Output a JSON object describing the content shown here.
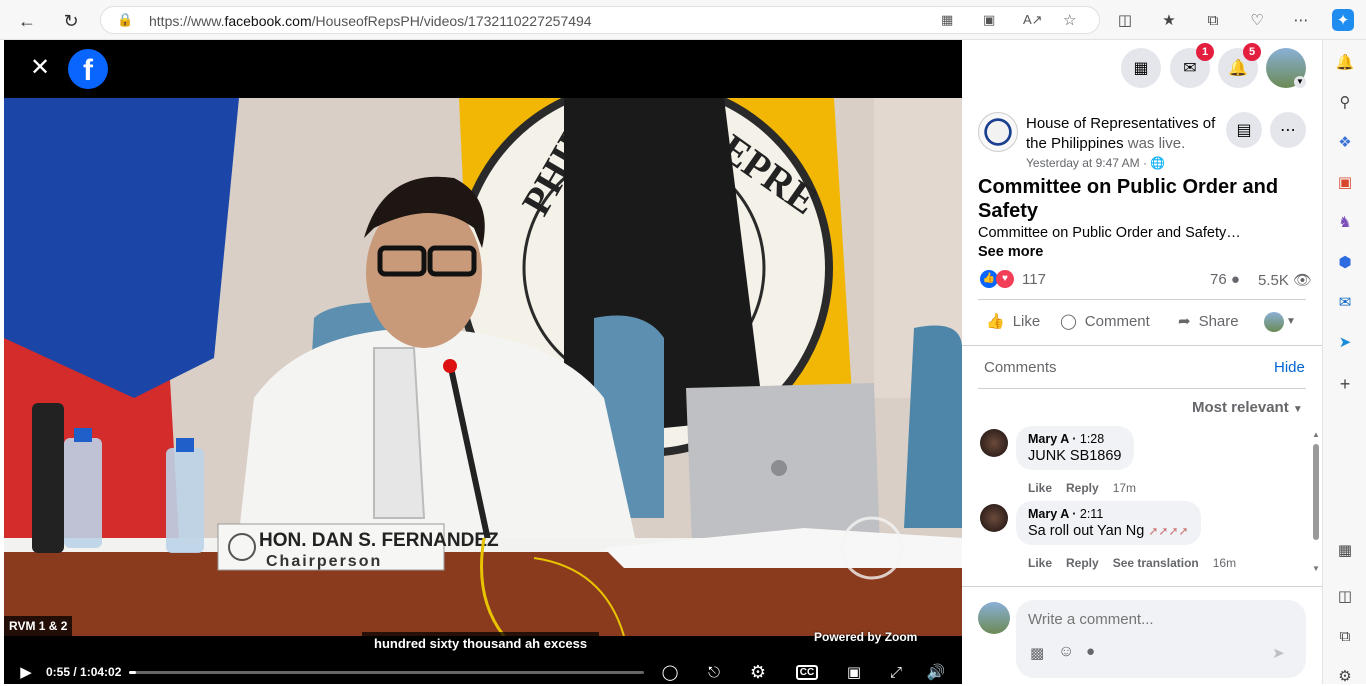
{
  "browser": {
    "url_prefix": "https://www.",
    "url_domain": "facebook.com",
    "url_path": "/HouseofRepsPH/videos/1732110227257494"
  },
  "video": {
    "subtitle": "hundred sixty thousand ah excess",
    "powered_by": "Powered by Zoom",
    "rvm_label": "RVM 1 & 2",
    "nameplate_name": "HON. DAN S. FERNANDEZ",
    "nameplate_role": "Chairperson",
    "time": "0:55 / 1:04:02",
    "progress": 0.0143
  },
  "header": {
    "messenger_badge": "1",
    "notifications_badge": "5"
  },
  "post": {
    "page_name": "House of Representatives of the Philippines",
    "live_text": "was live.",
    "timestamp": "Yesterday at 9:47 AM ·",
    "title": "Committee on Public Order and Safety",
    "description": "Committee on Public Order and Safety…",
    "see_more": "See more",
    "reactions_count": "117",
    "comments_count": "76",
    "views_count": "5.5K",
    "like_label": "Like",
    "comment_label": "Comment",
    "share_label": "Share"
  },
  "comments": {
    "header": "Comments",
    "hide": "Hide",
    "sort": "Most relevant",
    "items": [
      {
        "author": "Mary A",
        "time_in_video": "1:28",
        "text": "JUNK SB1869",
        "like": "Like",
        "reply": "Reply",
        "age": "17m"
      },
      {
        "author": "Mary A",
        "time_in_video": "2:11",
        "text": "Sa roll out Yan Ng",
        "like": "Like",
        "reply": "Reply",
        "translate": "See translation",
        "age": "16m"
      }
    ],
    "placeholder": "Write a comment..."
  },
  "colors": {
    "facebook_blue": "#0866ff",
    "badge_red": "#e41e3f",
    "link_blue": "#0064d1"
  }
}
